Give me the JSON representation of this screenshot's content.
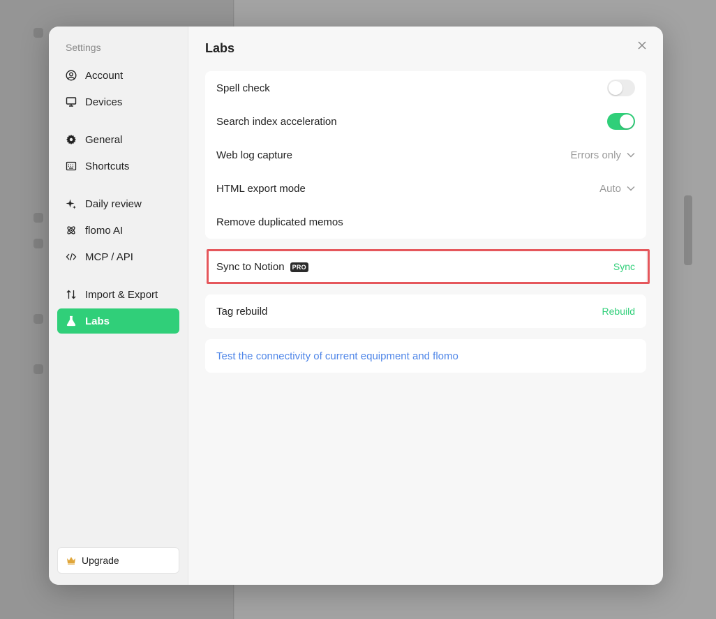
{
  "sidebar": {
    "title": "Settings",
    "items": [
      {
        "label": "Account",
        "icon": "account-circle-icon"
      },
      {
        "label": "Devices",
        "icon": "monitor-icon"
      },
      {
        "label": "General",
        "icon": "gear-icon"
      },
      {
        "label": "Shortcuts",
        "icon": "keyboard-icon"
      },
      {
        "label": "Daily review",
        "icon": "sparkle-icon"
      },
      {
        "label": "flomo AI",
        "icon": "atom-icon"
      },
      {
        "label": "MCP / API",
        "icon": "code-icon"
      },
      {
        "label": "Import & Export",
        "icon": "arrows-up-down-icon"
      },
      {
        "label": "Labs",
        "icon": "flask-icon",
        "active": true
      }
    ],
    "upgrade_label": "Upgrade"
  },
  "main": {
    "title": "Labs",
    "settings": {
      "spell_check": {
        "label": "Spell check",
        "enabled": false
      },
      "search_index": {
        "label": "Search index acceleration",
        "enabled": true
      },
      "web_log": {
        "label": "Web log capture",
        "value": "Errors only"
      },
      "html_export": {
        "label": "HTML export mode",
        "value": "Auto"
      },
      "remove_dup": {
        "label": "Remove duplicated memos"
      }
    },
    "sync_notion": {
      "label": "Sync to Notion",
      "badge": "PRO",
      "action": "Sync"
    },
    "tag_rebuild": {
      "label": "Tag rebuild",
      "action": "Rebuild"
    },
    "connectivity_link": "Test the connectivity of current equipment and flomo"
  },
  "colors": {
    "accent": "#30cf79",
    "link": "#4f86e8",
    "highlight": "#e5575c"
  }
}
